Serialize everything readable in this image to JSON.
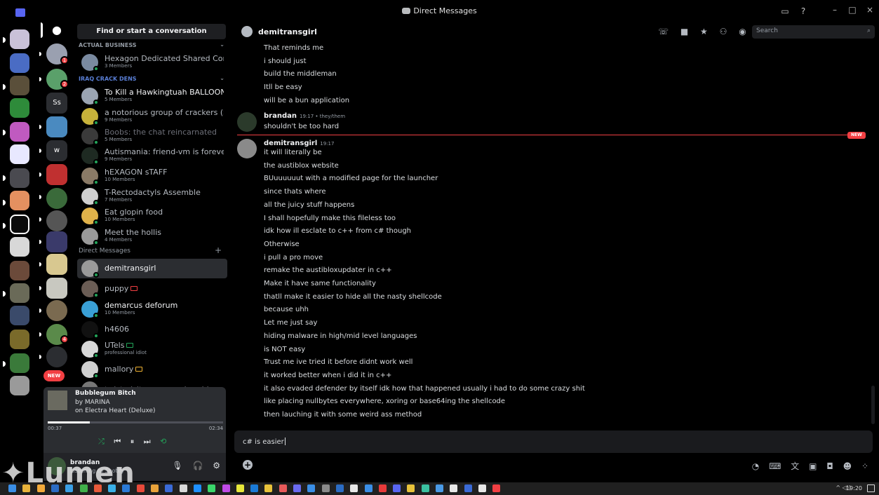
{
  "window": {
    "title": "Direct Messages",
    "controls": {
      "minimize": "–",
      "maximize": "□",
      "close": "×"
    }
  },
  "sidebar": {
    "find_button": "Find or start a conversation",
    "categories": {
      "actual_business": "ACTUAL BUSINESS",
      "iraq": "IRAQ CRACK DENS",
      "dms": "Direct Messages"
    },
    "groups": [
      {
        "name": "Hexagon Dedicated Shared Com...",
        "sub": "3 Members",
        "style": "normal",
        "color": "#7a8aa0"
      },
      {
        "name": "To Kill a Hawkingtuah BALLOON...",
        "sub": "5 Members",
        "style": "bright",
        "color": "#9aa4b2"
      },
      {
        "name": "a notorious group of crackers (S...",
        "sub": "9 Members",
        "style": "normal",
        "color": "#c7b23a"
      },
      {
        "name": "Boobs: the chat reincarnated",
        "sub": "5 Members",
        "style": "dim",
        "color": "#3a3a3a"
      },
      {
        "name": "Autismania: friend-vm is forever",
        "sub": "9 Members",
        "style": "normal",
        "color": "#1e2a22"
      },
      {
        "name": "hEXAGON sTAFF",
        "sub": "10 Members",
        "style": "normal",
        "color": "#8a7a66"
      },
      {
        "name": "T-Rectodactyls Assemble",
        "sub": "7 Members",
        "style": "normal",
        "color": "#cfcfcf"
      },
      {
        "name": "Eat glopin food",
        "sub": "10 Members",
        "style": "normal",
        "color": "#e0b24a"
      },
      {
        "name": "Meet the hollis",
        "sub": "4 Members",
        "style": "normal",
        "color": "#9a9a9a"
      }
    ],
    "add_dm": "+",
    "dms": [
      {
        "name": "demitransgirl",
        "sub": "",
        "style": "bright",
        "color": "#9a9a9a",
        "selected": true
      },
      {
        "name": "puppy",
        "sub": "",
        "style": "normal",
        "color": "#6b5d55",
        "tag": "red"
      },
      {
        "name": "demarcus deforum",
        "sub": "10 Members",
        "style": "bright",
        "color": "#3aa0d6"
      },
      {
        "name": "h4606",
        "sub": "",
        "style": "normal",
        "color": "#111111"
      },
      {
        "name": "UTels",
        "sub": "professional idiot",
        "style": "normal",
        "color": "#d8d8d8",
        "tag": "green"
      },
      {
        "name": "mallory",
        "sub": "",
        "style": "normal",
        "color": "#d0d0d0",
        "tag": "yellow"
      },
      {
        "name": "twistedsito uwu condos chiraq",
        "sub": "",
        "style": "dim",
        "color": "#777777"
      }
    ],
    "new_badge": "NEW"
  },
  "spotify": {
    "song": "Bubblegum Bitch",
    "artist": "by MARINA",
    "album": "on Electra Heart (Deluxe)",
    "elapsed": "00:37",
    "total": "02:34",
    "progress": 0.24
  },
  "user": {
    "name": "brandan",
    "status": "Listening to Spotify"
  },
  "watermark": "Lumen",
  "chat": {
    "recipient": "demitransgirl",
    "search_placeholder": "Search",
    "new_label": "NEW",
    "blocks": [
      {
        "author": "",
        "time": "",
        "lines": [
          "That reminds me",
          "i should just",
          "build the middleman",
          "Itll be easy",
          "will be a bun application"
        ]
      },
      {
        "author": "brandan",
        "time": "19:17 • they/them",
        "lines": [
          "shouldn't be too hard"
        ]
      },
      {
        "author": "demitransgirl",
        "time": "19:17",
        "lines": [
          "it will literally be",
          "the austiblox website",
          "BUuuuuuut with a modified page for the launcher",
          "since thats where",
          "all the juicy stuff happens",
          "I shall hopefully make this fileless too",
          "idk how ill esclate to c++ from c# though",
          "Otherwise",
          "i pull a pro move",
          "remake the austibloxupdater in c++",
          "Make it have same functionality",
          "thatll make it easier to hide all the nasty shellcode",
          "because uhh",
          "Let me just say",
          "hiding malware in high/mid level languages",
          "is NOT easy",
          "Trust me ive tried it before didnt work well",
          "it worked better when i did it in c++",
          "it also evaded defender by itself idk how that happened usually i had to do some crazy shit",
          "like placing nullbytes everywhere, xoring or base64ing the shellcode",
          "then lauching it with some weird ass method"
        ]
      }
    ],
    "composer_value": "c# is easier"
  },
  "taskbar": {
    "clock": "19:20",
    "tray": "^ ◁))"
  }
}
